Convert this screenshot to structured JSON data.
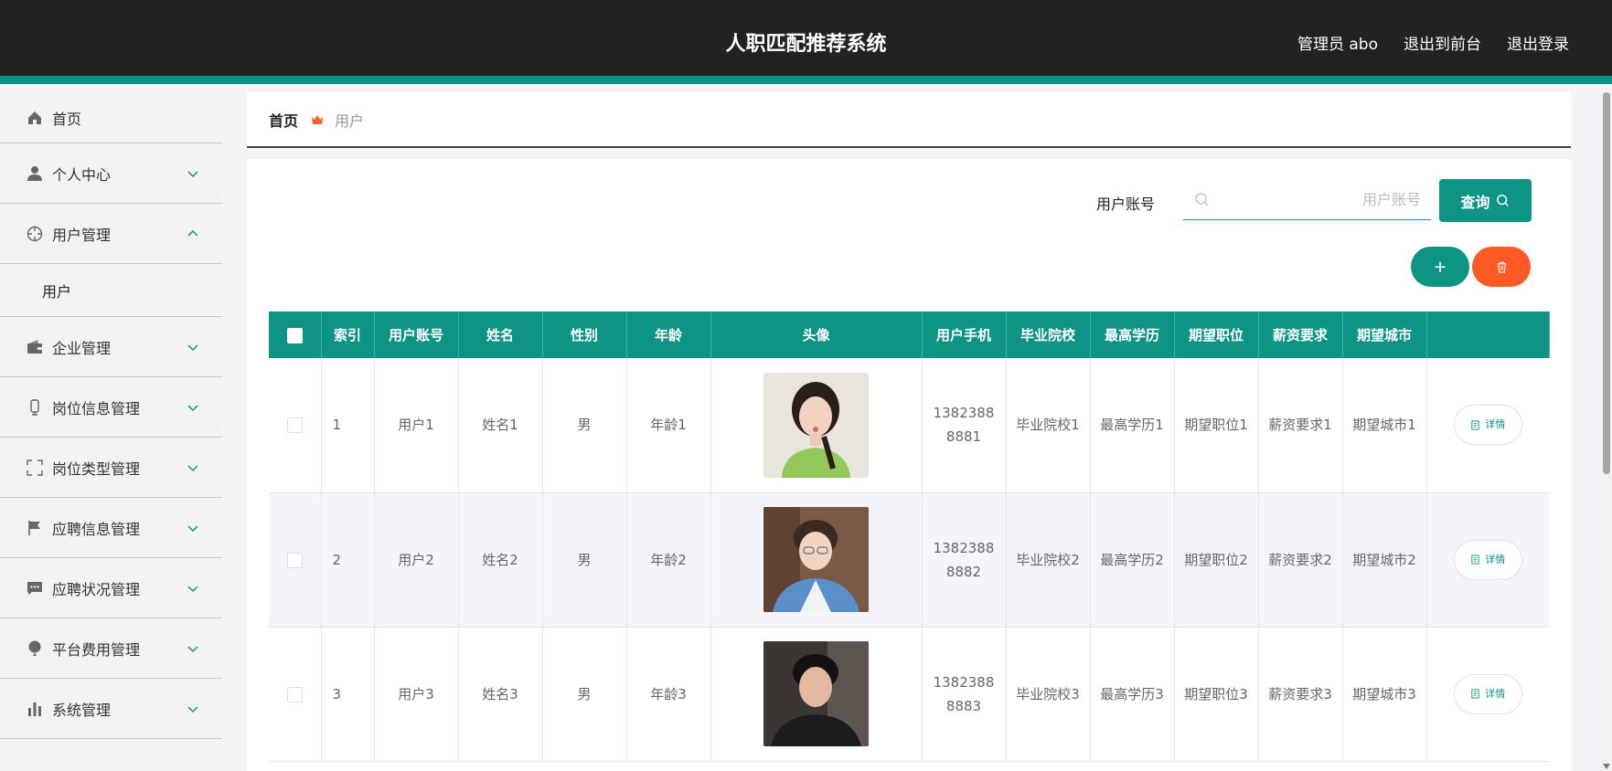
{
  "header": {
    "title": "人职匹配推荐系统",
    "admin_label": "管理员 abo",
    "front_label": "退出到前台",
    "logout_label": "退出登录"
  },
  "sidebar": {
    "items": [
      {
        "label": "首页",
        "icon": "home-icon"
      },
      {
        "label": "个人中心",
        "icon": "user-icon"
      },
      {
        "label": "用户管理",
        "icon": "crosshair-icon",
        "expanded": true
      },
      {
        "label": "用户"
      },
      {
        "label": "企业管理",
        "icon": "wallet-icon"
      },
      {
        "label": "岗位信息管理",
        "icon": "device-icon"
      },
      {
        "label": "岗位类型管理",
        "icon": "fullscreen-icon"
      },
      {
        "label": "应聘信息管理",
        "icon": "flag-icon"
      },
      {
        "label": "应聘状况管理",
        "icon": "message-icon"
      },
      {
        "label": "平台费用管理",
        "icon": "balloon-icon"
      },
      {
        "label": "系统管理",
        "icon": "chart-icon"
      }
    ]
  },
  "breadcrumb": {
    "home": "首页",
    "current": "用户"
  },
  "search": {
    "label": "用户账号",
    "placeholder": "用户账号",
    "button": "查询"
  },
  "actions": {
    "add": "+"
  },
  "table": {
    "headers": [
      "索引",
      "用户账号",
      "姓名",
      "性别",
      "年龄",
      "头像",
      "用户手机",
      "毕业院校",
      "最高学历",
      "期望职位",
      "薪资要求",
      "期望城市"
    ],
    "rows": [
      {
        "index": "1",
        "account": "用户1",
        "name": "姓名1",
        "gender": "男",
        "age": "年龄1",
        "phone": "13823888881",
        "school": "毕业院校1",
        "edu": "最高学历1",
        "position": "期望职位1",
        "salary": "薪资要求1",
        "city": "期望城市1",
        "detail": "详情"
      },
      {
        "index": "2",
        "account": "用户2",
        "name": "姓名2",
        "gender": "男",
        "age": "年龄2",
        "phone": "13823888882",
        "school": "毕业院校2",
        "edu": "最高学历2",
        "position": "期望职位2",
        "salary": "薪资要求2",
        "city": "期望城市2",
        "detail": "详情"
      },
      {
        "index": "3",
        "account": "用户3",
        "name": "姓名3",
        "gender": "男",
        "age": "年龄3",
        "phone": "13823888883",
        "school": "毕业院校3",
        "edu": "最高学历3",
        "position": "期望职位3",
        "salary": "薪资要求3",
        "city": "期望城市3",
        "detail": "详情"
      }
    ]
  },
  "colors": {
    "accent": "#0e9484",
    "danger": "#ff5a25",
    "header_bg": "#222222"
  }
}
